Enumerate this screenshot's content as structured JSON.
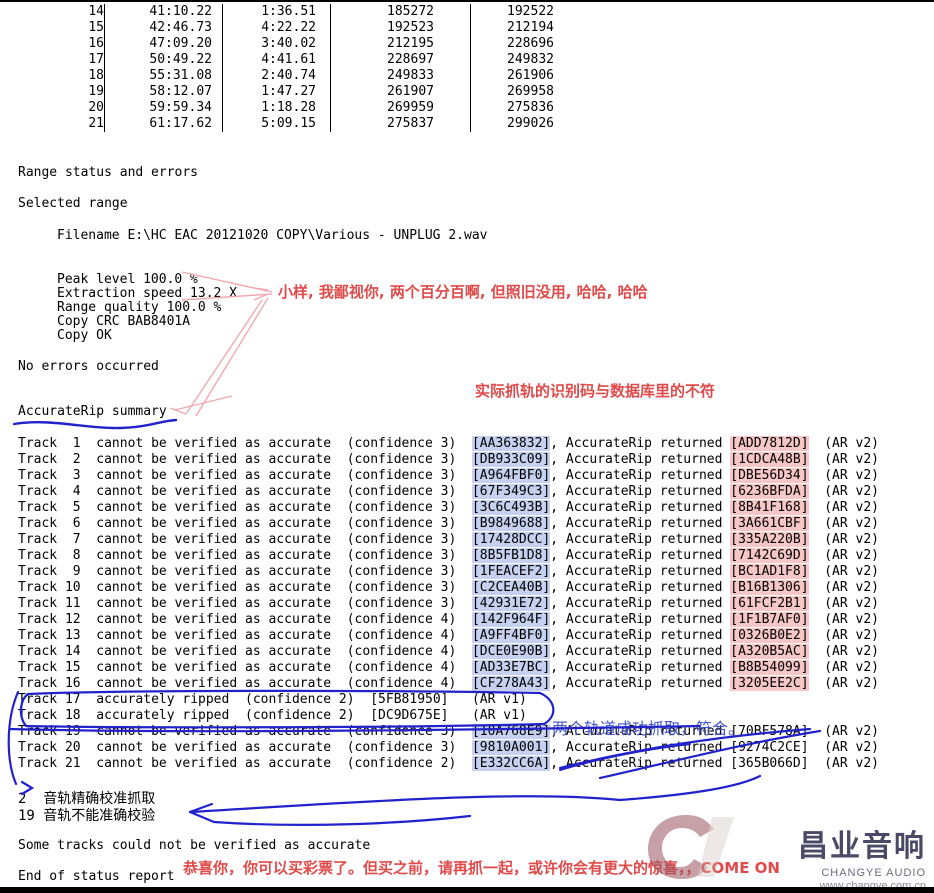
{
  "toc": {
    "columns": [
      "track",
      "start",
      "length",
      "start_sector",
      "end_sector"
    ],
    "rows": [
      {
        "track": "14",
        "start": "41:10.22",
        "length": "1:36.51",
        "s1": "185272",
        "s2": "192522"
      },
      {
        "track": "15",
        "start": "42:46.73",
        "length": "4:22.22",
        "s1": "192523",
        "s2": "212194"
      },
      {
        "track": "16",
        "start": "47:09.20",
        "length": "3:40.02",
        "s1": "212195",
        "s2": "228696"
      },
      {
        "track": "17",
        "start": "50:49.22",
        "length": "4:41.61",
        "s1": "228697",
        "s2": "249832"
      },
      {
        "track": "18",
        "start": "55:31.08",
        "length": "2:40.74",
        "s1": "249833",
        "s2": "261906"
      },
      {
        "track": "19",
        "start": "58:12.07",
        "length": "1:47.27",
        "s1": "261907",
        "s2": "269958"
      },
      {
        "track": "20",
        "start": "59:59.34",
        "length": "1:18.28",
        "s1": "269959",
        "s2": "275836"
      },
      {
        "track": "21",
        "start": "61:17.62",
        "length": "5:09.15",
        "s1": "275837",
        "s2": "299026"
      }
    ]
  },
  "report": {
    "range_status_heading": "Range status and errors",
    "selected_range_heading": "Selected range",
    "filename_line": "Filename E:\\HC EAC 20121020 COPY\\Various - UNPLUG 2.wav",
    "peak_level": "Peak level 100.0 %",
    "extraction_speed": "Extraction speed 13.2 X",
    "range_quality": "Range quality 100.0 %",
    "copy_crc": "Copy CRC BAB8401A",
    "copy_ok": "Copy OK",
    "no_errors": "No errors occurred",
    "summary_heading": "AccurateRip summary",
    "some_tracks": "Some tracks could not be verified as accurate",
    "end_of_report": "End of status report"
  },
  "accuraterip": {
    "tracks": [
      {
        "label": "Track  1",
        "status": "cannot be verified as accurate",
        "confidence": "(confidence 3)",
        "crc": "[AA363832]",
        "tail": ", AccurateRip returned",
        "returned": "[ADD7812D]",
        "version": "(AR v2)"
      },
      {
        "label": "Track  2",
        "status": "cannot be verified as accurate",
        "confidence": "(confidence 3)",
        "crc": "[DB933C09]",
        "tail": ", AccurateRip returned",
        "returned": "[1CDCA48B]",
        "version": "(AR v2)"
      },
      {
        "label": "Track  3",
        "status": "cannot be verified as accurate",
        "confidence": "(confidence 3)",
        "crc": "[A964FBF0]",
        "tail": ", AccurateRip returned",
        "returned": "[DBE56D34]",
        "version": "(AR v2)"
      },
      {
        "label": "Track  4",
        "status": "cannot be verified as accurate",
        "confidence": "(confidence 3)",
        "crc": "[67F349C3]",
        "tail": ", AccurateRip returned",
        "returned": "[6236BFDA]",
        "version": "(AR v2)"
      },
      {
        "label": "Track  5",
        "status": "cannot be verified as accurate",
        "confidence": "(confidence 3)",
        "crc": "[3C6C493B]",
        "tail": ", AccurateRip returned",
        "returned": "[8B41F168]",
        "version": "(AR v2)"
      },
      {
        "label": "Track  6",
        "status": "cannot be verified as accurate",
        "confidence": "(confidence 3)",
        "crc": "[B9849688]",
        "tail": ", AccurateRip returned",
        "returned": "[3A661CBF]",
        "version": "(AR v2)"
      },
      {
        "label": "Track  7",
        "status": "cannot be verified as accurate",
        "confidence": "(confidence 3)",
        "crc": "[17428DCC]",
        "tail": ", AccurateRip returned",
        "returned": "[335A220B]",
        "version": "(AR v2)"
      },
      {
        "label": "Track  8",
        "status": "cannot be verified as accurate",
        "confidence": "(confidence 3)",
        "crc": "[8B5FB1D8]",
        "tail": ", AccurateRip returned",
        "returned": "[7142C69D]",
        "version": "(AR v2)"
      },
      {
        "label": "Track  9",
        "status": "cannot be verified as accurate",
        "confidence": "(confidence 3)",
        "crc": "[1FEACEF2]",
        "tail": ", AccurateRip returned",
        "returned": "[BC1AD1F8]",
        "version": "(AR v2)"
      },
      {
        "label": "Track 10",
        "status": "cannot be verified as accurate",
        "confidence": "(confidence 3)",
        "crc": "[C2CEA40B]",
        "tail": ", AccurateRip returned",
        "returned": "[B16B1306]",
        "version": "(AR v2)"
      },
      {
        "label": "Track 11",
        "status": "cannot be verified as accurate",
        "confidence": "(confidence 3)",
        "crc": "[42931E72]",
        "tail": ", AccurateRip returned",
        "returned": "[61FCF2B1]",
        "version": "(AR v2)"
      },
      {
        "label": "Track 12",
        "status": "cannot be verified as accurate",
        "confidence": "(confidence 4)",
        "crc": "[142F964F]",
        "tail": ", AccurateRip returned",
        "returned": "[1F1B7AF0]",
        "version": "(AR v2)"
      },
      {
        "label": "Track 13",
        "status": "cannot be verified as accurate",
        "confidence": "(confidence 4)",
        "crc": "[A9FF4BF0]",
        "tail": ", AccurateRip returned",
        "returned": "[0326B0E2]",
        "version": "(AR v2)"
      },
      {
        "label": "Track 14",
        "status": "cannot be verified as accurate",
        "confidence": "(confidence 4)",
        "crc": "[DCE0E90B]",
        "tail": ", AccurateRip returned",
        "returned": "[A320B5AC]",
        "version": "(AR v2)"
      },
      {
        "label": "Track 15",
        "status": "cannot be verified as accurate",
        "confidence": "(confidence 4)",
        "crc": "[AD33E7BC]",
        "tail": ", AccurateRip returned",
        "returned": "[B8B54099]",
        "version": "(AR v2)"
      },
      {
        "label": "Track 16",
        "status": "cannot be verified as accurate",
        "confidence": "(confidence 4)",
        "crc": "[CF278A43]",
        "tail": ", AccurateRip returned",
        "returned": "[3205EE2C]",
        "version": "(AR v2)"
      }
    ],
    "ripped": [
      {
        "label": "Track 17",
        "status": "accurately ripped",
        "confidence": "(confidence 2)",
        "crc": "[5FB81950]",
        "version": "(AR v1)"
      },
      {
        "label": "Track 18",
        "status": "accurately ripped",
        "confidence": "(confidence 2)",
        "crc": "[DC9D675E]",
        "version": "(AR v1)"
      }
    ],
    "tail_tracks": [
      {
        "label": "Track 19",
        "status": "cannot be verified as accurate",
        "confidence": "(confidence 3)",
        "crc": "[10A768E9]",
        "tail": ", AccurateRip returned",
        "returned": "[70BF578A]",
        "version": "(AR v2)"
      },
      {
        "label": "Track 20",
        "status": "cannot be verified as accurate",
        "confidence": "(confidence 3)",
        "crc": "[9810A001]",
        "tail": ", AccurateRip returned",
        "returned": "[9274C2CE]",
        "version": "(AR v2)"
      },
      {
        "label": "Track 21",
        "status": "cannot be verified as accurate",
        "confidence": "(confidence 2)",
        "crc": "[E332CC6A]",
        "tail": ", AccurateRip returned",
        "returned": "[365B066D]",
        "version": "(AR v2)"
      }
    ]
  },
  "handwritten": {
    "count_ok": "2  音轨精确校准抓取",
    "count_bad": "19 音轨不能准确校验"
  },
  "annotations": {
    "red_percent": "小样, 我鄙视你, 两个百分百啊, 但照旧没用, 哈哈, 哈哈",
    "red_mismatch": "实际抓轨的识别码与数据库里的不符",
    "blue_two_ok": "两个轨道成功抓取，符合。",
    "red_bottom": "恭喜你，你可以买彩票了。但买之前，请再抓一起，或许你会有更大的惊喜，，COME ON"
  },
  "colors": {
    "highlight_blue": "#c6d1ef",
    "highlight_pink": "#f6c7c6",
    "annotation_red": "#e04a4a",
    "annotation_blue": "#4455cc",
    "ink_blue": "#2222cc",
    "ink_pink": "#f0a8b0"
  },
  "watermark": {
    "cjk": "昌业音响",
    "en": "CHANGYE AUDIO",
    "url": "www.changye.com.cn"
  }
}
